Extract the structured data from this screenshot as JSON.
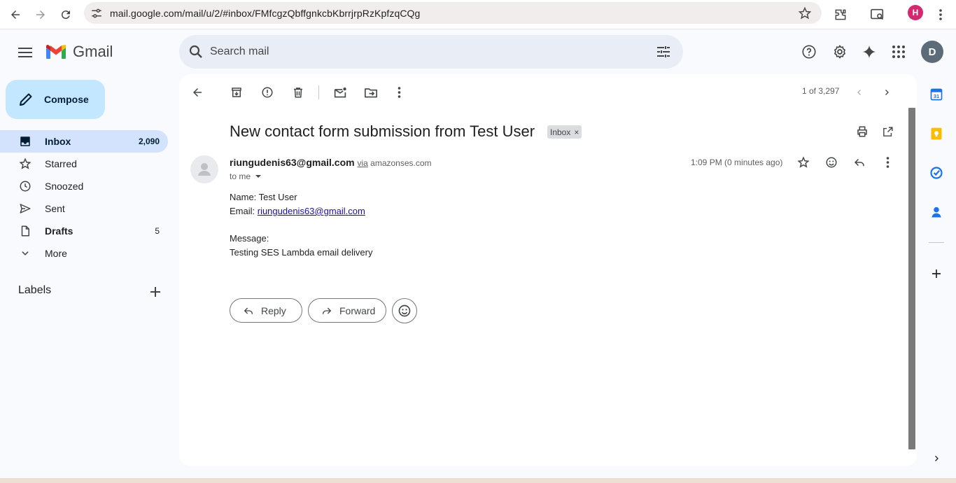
{
  "browser": {
    "url": "mail.google.com/mail/u/2/#inbox/FMfcgzQbffgnkcbKbrrjrpRzKpfzqCQg",
    "profile_initial": "H"
  },
  "header": {
    "app_name": "Gmail",
    "search_placeholder": "Search mail",
    "avatar_initial": "D"
  },
  "sidebar": {
    "compose_label": "Compose",
    "items": [
      {
        "label": "Inbox",
        "count": "2,090",
        "icon": "inbox-icon"
      },
      {
        "label": "Starred",
        "count": "",
        "icon": "star-icon"
      },
      {
        "label": "Snoozed",
        "count": "",
        "icon": "clock-icon"
      },
      {
        "label": "Sent",
        "count": "",
        "icon": "send-icon"
      },
      {
        "label": "Drafts",
        "count": "5",
        "icon": "draft-icon"
      },
      {
        "label": "More",
        "count": "",
        "icon": "chevron-down-icon"
      }
    ],
    "labels_heading": "Labels"
  },
  "toolbar": {
    "pager": "1 of 3,297"
  },
  "message": {
    "subject": "New contact form submission from Test User",
    "chip_label": "Inbox",
    "sender_email": "riungudenis63@gmail.com",
    "via_word": "via",
    "via_domain": "amazonses.com",
    "to_line": "to me",
    "time": "1:09 PM (0 minutes ago)",
    "body": {
      "name_line": "Name: Test User",
      "email_prefix": "Email: ",
      "email_link": "riungudenis63@gmail.com",
      "message_label": "Message:",
      "message_text": "Testing SES Lambda email delivery"
    },
    "reply_label": "Reply",
    "forward_label": "Forward"
  },
  "colors": {
    "accent": "#0b57d0",
    "compose_bg": "#c2e7ff",
    "active_nav": "#d3e3fd"
  }
}
